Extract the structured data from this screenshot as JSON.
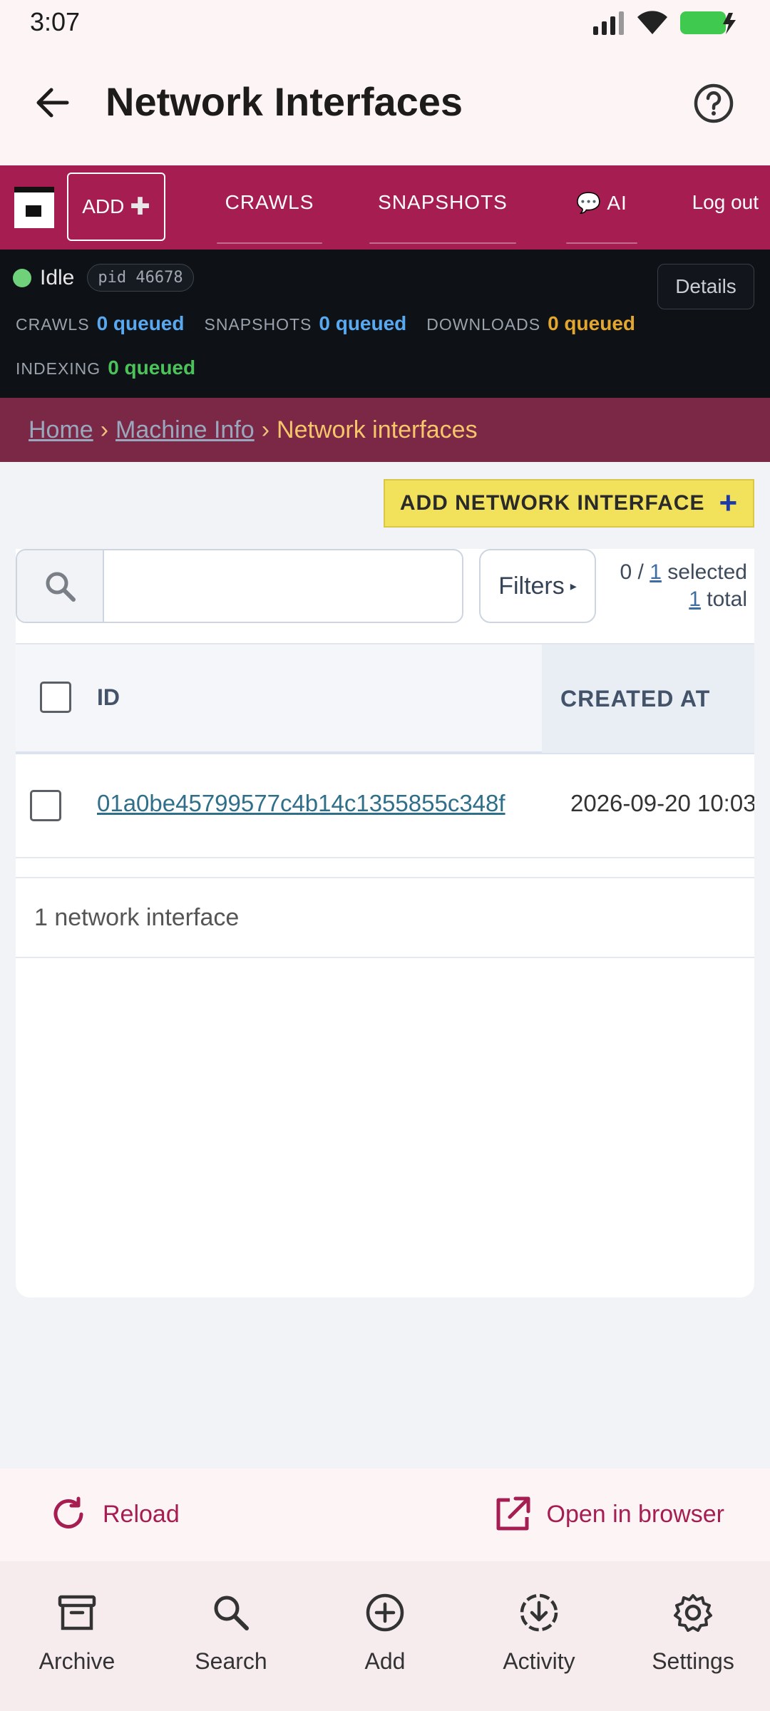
{
  "status_bar": {
    "time": "3:07"
  },
  "app_bar": {
    "title": "Network Interfaces"
  },
  "top_nav": {
    "add_label": "ADD",
    "tabs": [
      {
        "label": "CRAWLS"
      },
      {
        "label": "SNAPSHOTS"
      },
      {
        "label": "💬 AI"
      }
    ],
    "logout_label": "Log out"
  },
  "status_panel": {
    "state": "Idle",
    "pid": "pid 46678",
    "details_label": "Details",
    "queues": [
      {
        "label": "CRAWLS",
        "value": "0 queued",
        "color": "#59a9f0"
      },
      {
        "label": "SNAPSHOTS",
        "value": "0 queued",
        "color": "#59a9f0"
      },
      {
        "label": "DOWNLOADS",
        "value": "0 queued",
        "color": "#e3a62e"
      },
      {
        "label": "INDEXING",
        "value": "0 queued",
        "color": "#4cc35a"
      }
    ]
  },
  "breadcrumb": {
    "home": "Home",
    "machine_info": "Machine Info",
    "separator": "›",
    "current": "Network interfaces"
  },
  "add_button_label": "ADD NETWORK INTERFACE",
  "toolbar": {
    "search_placeholder": "",
    "filters_label": "Filters",
    "selected_count": "0",
    "selected_sep": " / ",
    "selected_total": "1",
    "selected_suffix": " selected",
    "total_count": "1",
    "total_suffix": " total"
  },
  "table": {
    "columns": {
      "id": "ID",
      "created_at": "CREATED AT"
    },
    "rows": [
      {
        "id": "01a0be45799577c4b14c1355855c348f",
        "created_at": "2026-09-20 10:03"
      }
    ],
    "footer": "1 network interface"
  },
  "actions": {
    "reload": "Reload",
    "open_browser": "Open in browser"
  },
  "bottom_nav": [
    {
      "label": "Archive",
      "icon": "archive-icon"
    },
    {
      "label": "Search",
      "icon": "search-icon"
    },
    {
      "label": "Add",
      "icon": "add-circle-icon"
    },
    {
      "label": "Activity",
      "icon": "activity-icon"
    },
    {
      "label": "Settings",
      "icon": "settings-icon"
    }
  ],
  "colors": {
    "brand": "#a61d52",
    "accent_yellow": "#f2e15b",
    "breadcrumb_bg": "#7a2845",
    "panel_bg": "#0e1116"
  }
}
